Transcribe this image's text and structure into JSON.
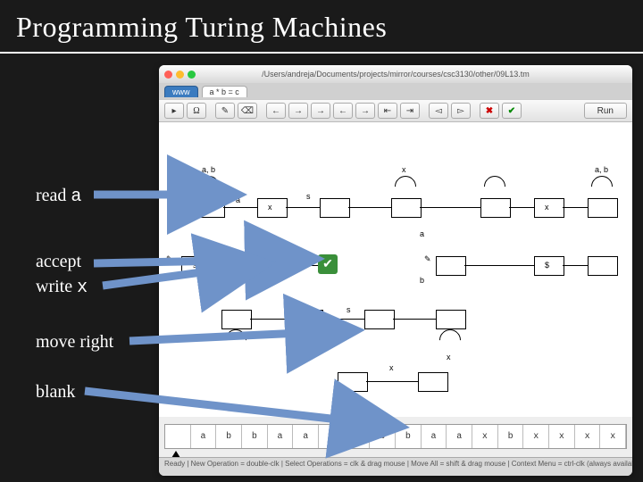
{
  "title": "Programming Turing Machines",
  "labels": {
    "read": "read ",
    "read_sym": "a",
    "accept": "accept",
    "write": "write ",
    "write_sym": "x",
    "move": "move right",
    "blank": "blank"
  },
  "window": {
    "path": "/Users/andreja/Documents/projects/mirror/courses/csc3130/other/09L13.tm",
    "tabs": {
      "www": "www",
      "file": "a * b = c"
    },
    "toolbar": {
      "cursor": "▸",
      "halt": "Ω",
      "scribble": "✎",
      "erase": "⌫",
      "left": "←",
      "right": "→",
      "up": "↑",
      "down": "↓",
      "rewind": "⇤",
      "ff": "⇥",
      "back": "◅",
      "fwd": "▻",
      "delete": "✖",
      "check": "✔",
      "run": "Run"
    },
    "canvas_labels": {
      "ab": "a, b",
      "x": "x",
      "s": "s",
      "$": "$",
      "a": "a",
      "b": "b",
      "read_tag": "a",
      "write_tag": "x"
    },
    "tape": [
      "",
      "a",
      "b",
      "b",
      "a",
      "a",
      "$",
      "a",
      "b",
      "b",
      "a",
      "a",
      "x",
      "b",
      "x",
      "x",
      "x",
      "x"
    ],
    "status": "Ready | New Operation = double-clk | Select Operations = clk & drag mouse | Move All = shift & drag mouse | Context Menu = ctrl-clk (always available)"
  }
}
